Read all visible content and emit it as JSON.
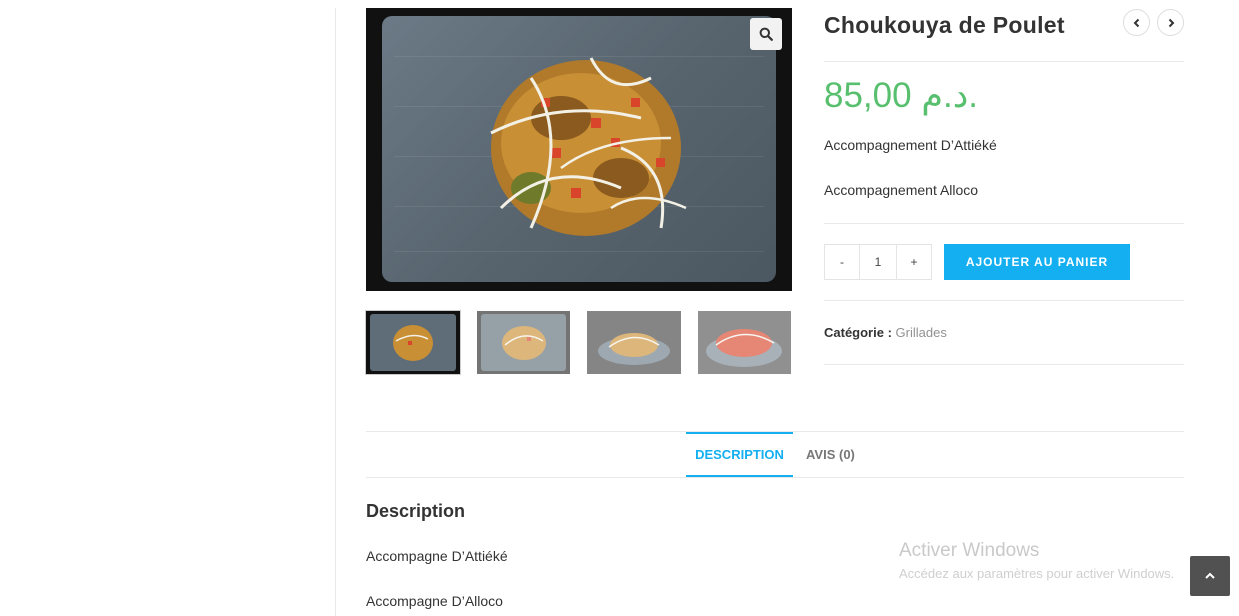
{
  "product": {
    "title": "Choukouya de Poulet",
    "price": "85,00 د.م.",
    "accompaniments": [
      "Accompagnement D’Attiéké",
      "Accompagnement Alloco"
    ],
    "quantity": "1",
    "minus_label": "-",
    "plus_label": "+",
    "add_to_cart_label": "AJOUTER AU PANIER",
    "category_label": "Catégorie :",
    "category_value": "Grillades"
  },
  "tabs": [
    {
      "label": "DESCRIPTION",
      "active": true
    },
    {
      "label": "AVIS (0)",
      "active": false
    }
  ],
  "description": {
    "heading": "Description",
    "lines": [
      "Accompagne D’Attiéké",
      "Accompagne D’Alloco"
    ]
  },
  "windows_watermark": {
    "title": "Activer Windows",
    "subtitle": "Accédez aux paramètres pour activer Windows."
  },
  "icons": {
    "zoom": "magnifier-icon",
    "prev": "chevron-left-icon",
    "next": "chevron-right-icon",
    "scroll_top": "chevron-up-icon"
  },
  "colors": {
    "price": "#57bf6d",
    "accent": "#13aff0"
  }
}
